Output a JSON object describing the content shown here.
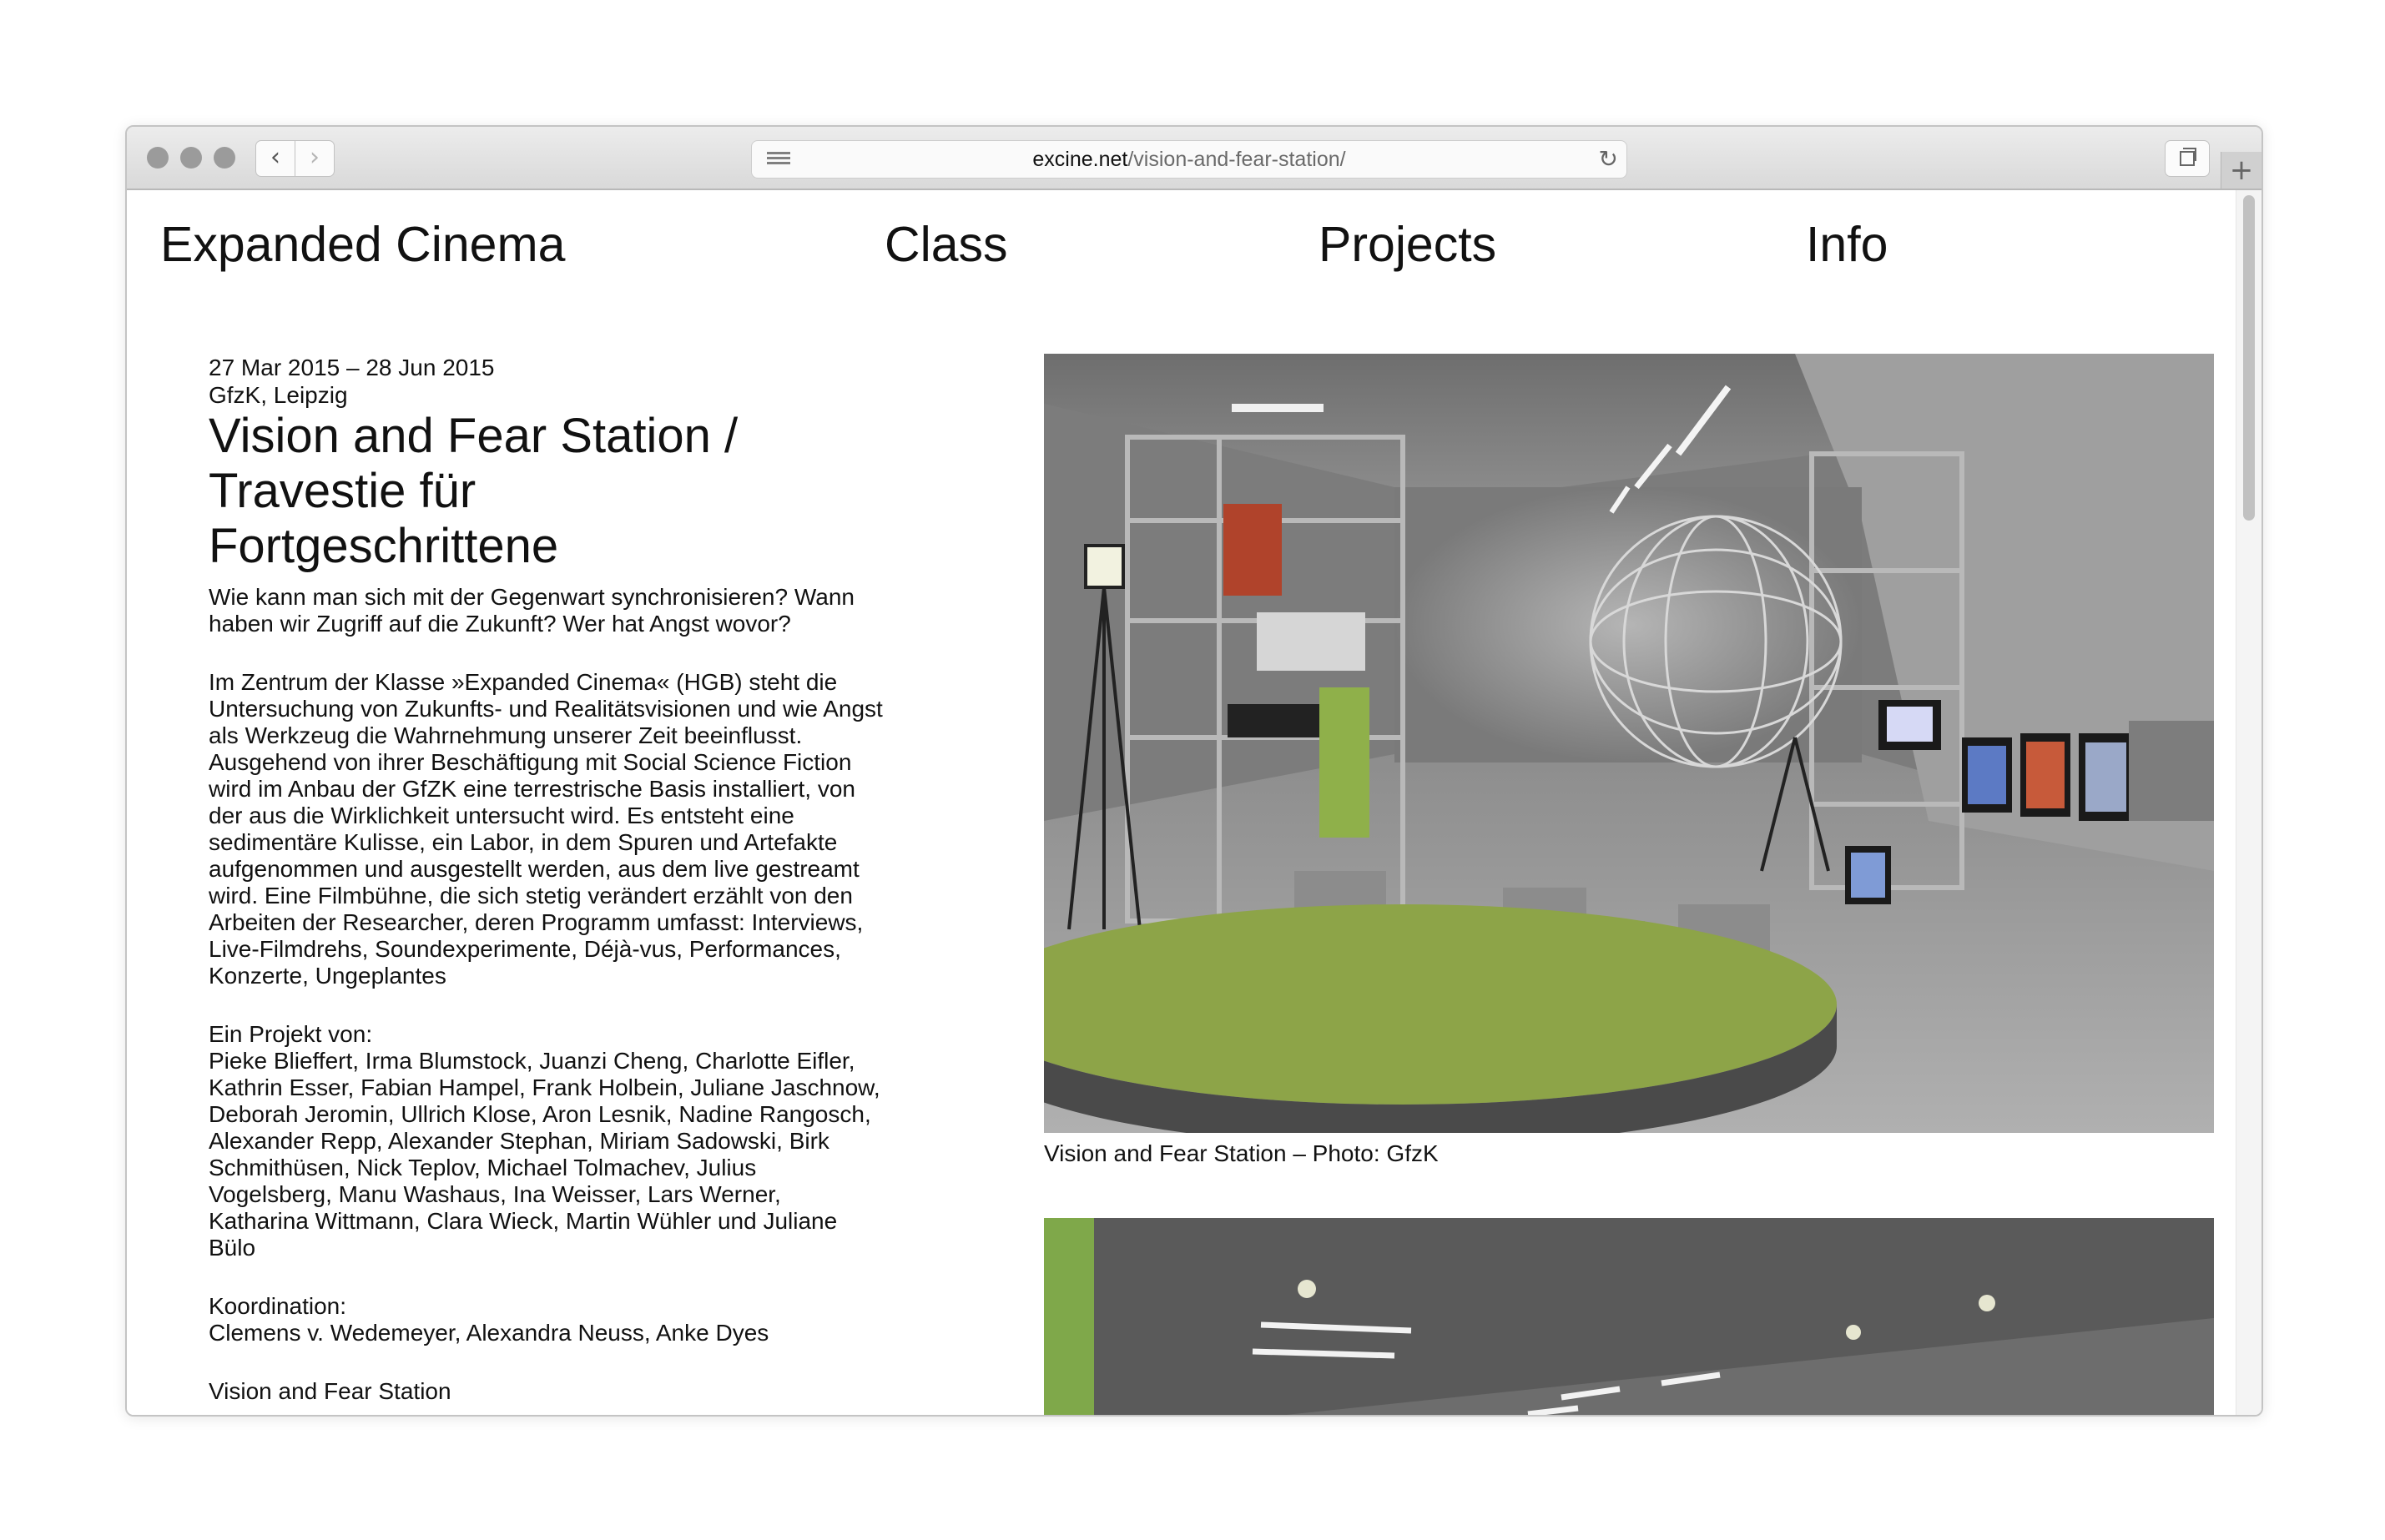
{
  "browser": {
    "url_domain": "excine.net",
    "url_path": "/vision-and-fear-station/"
  },
  "site": {
    "nav": [
      "Expanded Cinema",
      "Class",
      "Projects",
      "Info"
    ]
  },
  "project": {
    "date": "27 Mar 2015 – 28 Jun 2015",
    "venue": "GfzK, Leipzig",
    "title_lines": [
      "Vision and Fear Station /",
      "Travestie für",
      "Fortgeschrittene"
    ],
    "intro": "Wie kann man sich mit der Gegenwart synchronisieren? Wann haben wir Zugriff auf die Zukunft? Wer hat Angst wovor?",
    "description": "Im Zentrum der Klasse »Expanded Cinema« (HGB) steht die Untersuchung von Zukunfts- und Realitätsvisionen und wie Angst als Werkzeug die Wahrnehmung unserer Zeit beeinflusst. Ausgehend von ihrer Beschäftigung mit Social Science Fiction wird im Anbau der GfZK eine terrestrische Basis installiert, von der aus die Wirklichkeit untersucht wird. Es entsteht eine sedimentäre Kulisse, ein Labor, in dem Spuren und Artefakte aufgenommen und ausgestellt werden, aus dem live gestreamt wird. Eine Filmbühne, die sich stetig verändert erzählt von den Arbeiten der Researcher, deren Programm umfasst: Interviews, Live-Filmdrehs, Soundexperimente, Déjà-vus, Performances, Konzerte, Ungeplantes",
    "project_by_label": "Ein Projekt von:",
    "participants": "Pieke Blieffert, Irma Blumstock, Juanzi Cheng, Charlotte Eifler, Kathrin Esser, Fabian Hampel, Frank Holbein, Juliane Jaschnow, Deborah Jeromin, Ullrich Klose, Aron Lesnik, Nadine Rangosch, Alexander Repp, Alexander Stephan, Miriam Sadowski, Birk Schmithüsen, Nick Teplov, Michael Tolmachev, Julius Vogelsberg, Manu Washaus, Ina Weisser, Lars Werner, Katharina Wittmann, Clara Wieck, Martin Wühler und Juliane Bülo",
    "coordination_label": "Koordination:",
    "coordination": "Clemens v. Wedemeyer,  Alexandra Neuss, Anke Dyes",
    "footer_label": "Vision and Fear Station",
    "photo_caption": "Vision and Fear Station – Photo: GfzK"
  }
}
